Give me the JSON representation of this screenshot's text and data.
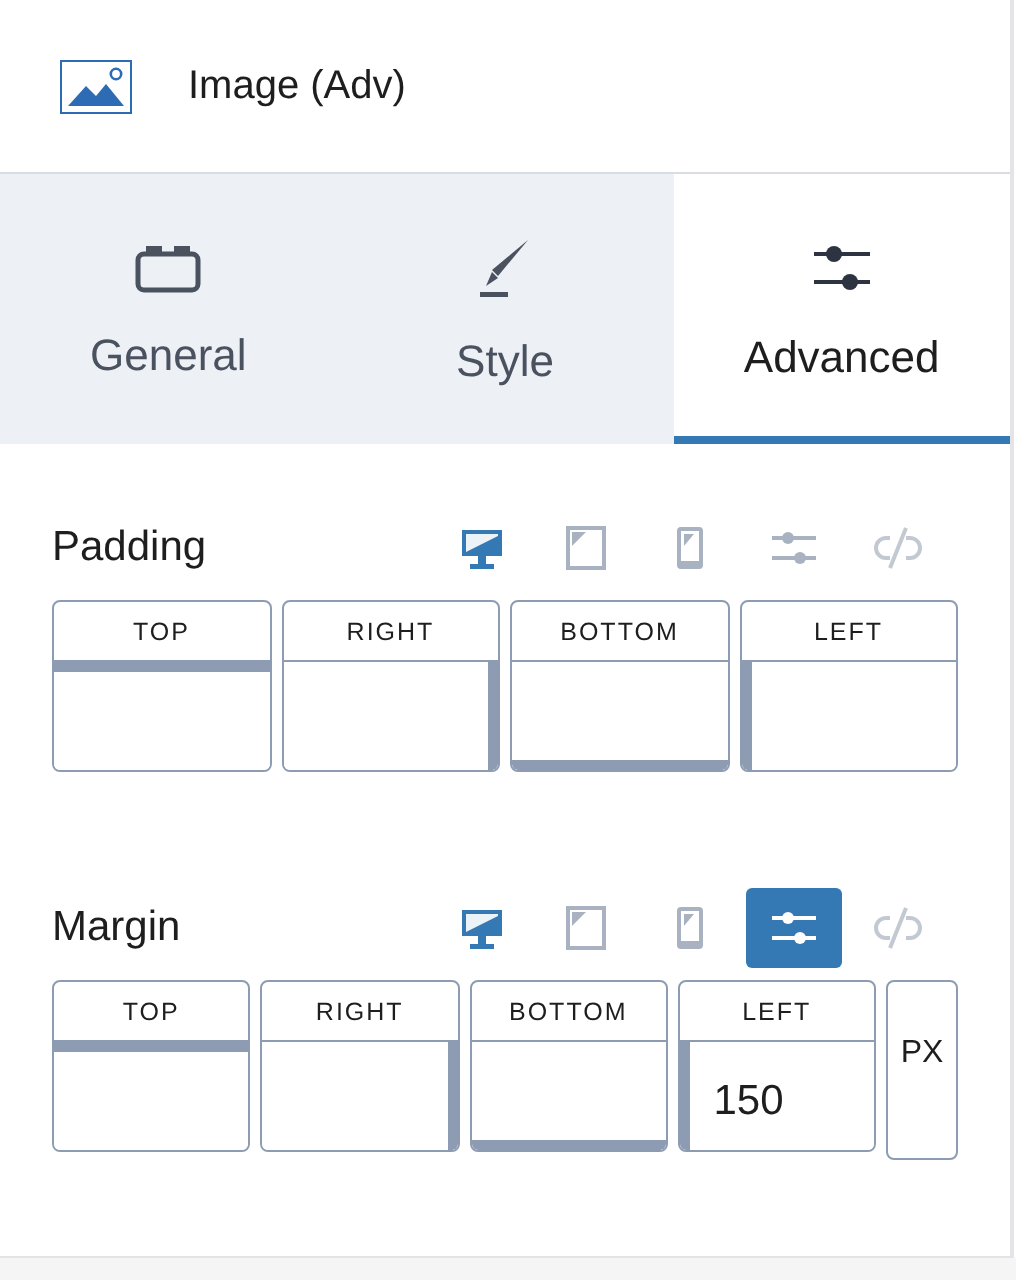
{
  "header": {
    "title": "Image (Adv)"
  },
  "tabs": [
    {
      "label": "General",
      "kind": "general",
      "selected": false
    },
    {
      "label": "Style",
      "kind": "style",
      "selected": false
    },
    {
      "label": "Advanced",
      "kind": "advanced",
      "selected": true
    }
  ],
  "sections": [
    {
      "title": "Padding",
      "tools": [
        {
          "kind": "desktop",
          "selected": true
        },
        {
          "kind": "tablet",
          "selected": false
        },
        {
          "kind": "mobile",
          "selected": false
        },
        {
          "kind": "sliders",
          "selected": false
        },
        {
          "kind": "link",
          "selected": false
        }
      ],
      "sides": [
        {
          "label": "TOP"
        },
        {
          "label": "RIGHT"
        },
        {
          "label": "BOTTOM"
        },
        {
          "label": "LEFT"
        }
      ]
    },
    {
      "title": "Margin",
      "tools": [
        {
          "kind": "desktop",
          "selected": true
        },
        {
          "kind": "tablet",
          "selected": false
        },
        {
          "kind": "mobile",
          "selected": false
        },
        {
          "kind": "sliders",
          "selected": true
        },
        {
          "kind": "link",
          "selected": false
        }
      ],
      "sides": [
        {
          "label": "TOP"
        },
        {
          "label": "RIGHT"
        },
        {
          "label": "BOTTOM"
        },
        {
          "label": "LEFT",
          "value": "150"
        }
      ],
      "unit": "PX"
    }
  ]
}
